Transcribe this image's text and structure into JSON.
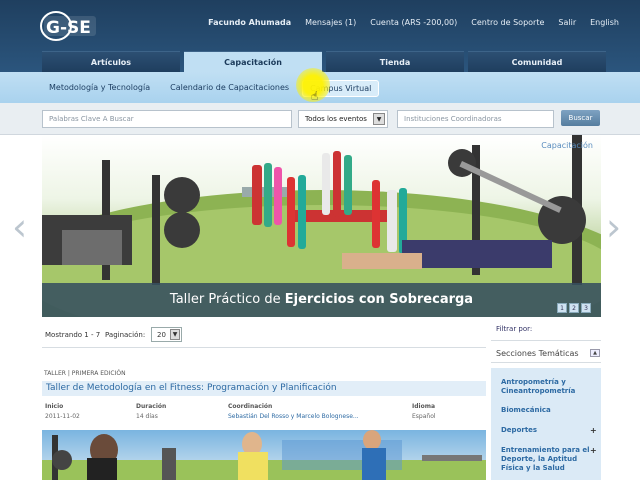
{
  "header": {
    "logo_text": "G-SE",
    "user": "Facundo Ahumada",
    "messages": "Mensajes (1)",
    "account": "Cuenta (ARS -200,00)",
    "support": "Centro de Soporte",
    "logout": "Salir",
    "language": "English"
  },
  "main_tabs": [
    "Artículos",
    "Capacitación",
    "Tienda",
    "Comunidad"
  ],
  "sub_tabs": [
    "Metodología y Tecnología",
    "Calendario de Capacitaciones",
    "Campus Virtual"
  ],
  "search": {
    "keywords_placeholder": "Palabras Clave A Buscar",
    "events_value": "Todos los eventos",
    "institutions_placeholder": "Instituciones Coordinadoras",
    "button": "Buscar"
  },
  "banner": {
    "tag": "Capacitación",
    "caption_prefix": "Taller Práctico de ",
    "caption_bold": "Ejercicios con Sobrecarga",
    "pages": [
      "1",
      "2",
      "3"
    ],
    "prev_glyph": "‹",
    "next_glyph": "›"
  },
  "list": {
    "showing": "Mostrando 1 - 7",
    "pagination_label": "Paginación:",
    "page_size": "20"
  },
  "course": {
    "meta": "TALLER | PRIMERA EDICIÓN",
    "title": "Taller de Metodología en el Fitness: Programación y Planificación",
    "start_label": "Inicio",
    "start_value": "2011-11-02",
    "duration_label": "Duración",
    "duration_value": "14 días",
    "coord_label": "Coordinación",
    "coord_value": "Sebastián Del Rosso y Marcelo Bolognese...",
    "language_label": "Idioma",
    "language_value": "Español"
  },
  "sidebar": {
    "filter_label": "Filtrar por:",
    "section": "Secciones Temáticas",
    "items": [
      {
        "label": "Antropometría y Cineantropometría",
        "plus": ""
      },
      {
        "label": "Biomecánica",
        "plus": ""
      },
      {
        "label": "Deportes",
        "plus": "+"
      },
      {
        "label": "Entrenamiento para el Deporte, la Aptitud Física y la Salud",
        "plus": "+"
      }
    ]
  },
  "colors": {
    "header": "#1f3f5f",
    "subnav": "#c0dff3",
    "link": "#2d6aa3",
    "cursor_highlight": "#fff200"
  }
}
